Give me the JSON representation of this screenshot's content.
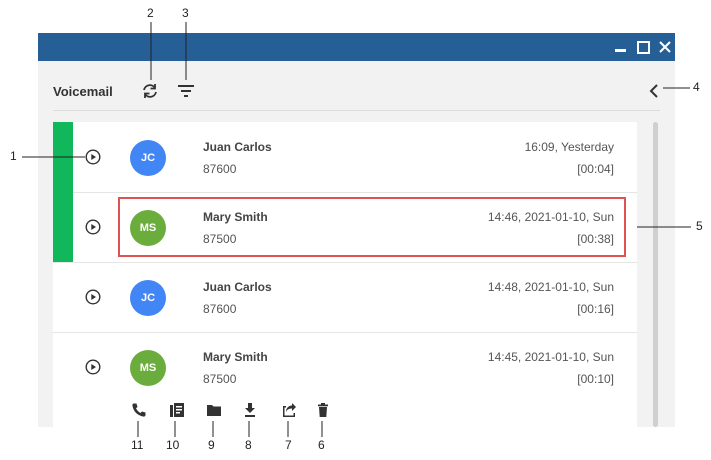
{
  "window": {
    "title_controls": {
      "minimize_icon": "minimize-icon",
      "maximize_icon": "maximize-icon",
      "close_icon": "close-icon"
    },
    "colors": {
      "titlebar": "#255f95",
      "unread": "#10b75b",
      "avatar_jc": "#4285f4",
      "avatar_ms": "#6aad3d",
      "highlight": "#e05252"
    }
  },
  "header": {
    "title": "Voicemail",
    "refresh_icon": "refresh-icon",
    "filter_icon": "filter-icon",
    "collapse_icon": "chevron-left-icon"
  },
  "voicemails": [
    {
      "name": "Juan Carlos",
      "number": "87600",
      "time": "16:09, Yesterday",
      "duration": "[00:04]",
      "initials": "JC",
      "unread": true
    },
    {
      "name": "Mary Smith",
      "number": "87500",
      "time": "14:46, 2021-01-10, Sun",
      "duration": "[00:38]",
      "initials": "MS",
      "unread": true
    },
    {
      "name": "Juan Carlos",
      "number": "87600",
      "time": "14:48, 2021-01-10, Sun",
      "duration": "[00:16]",
      "initials": "JC",
      "unread": false
    },
    {
      "name": "Mary Smith",
      "number": "87500",
      "time": "14:45, 2021-01-10, Sun",
      "duration": "[00:10]",
      "initials": "MS",
      "unread": false
    }
  ],
  "actions": [
    "call-icon",
    "transcript-icon",
    "folder-icon",
    "download-icon",
    "forward-icon",
    "delete-icon"
  ],
  "callouts": {
    "c1": "1",
    "c2": "2",
    "c3": "3",
    "c4": "4",
    "c5": "5",
    "c6": "6",
    "c7": "7",
    "c8": "8",
    "c9": "9",
    "c10": "10",
    "c11": "11"
  }
}
